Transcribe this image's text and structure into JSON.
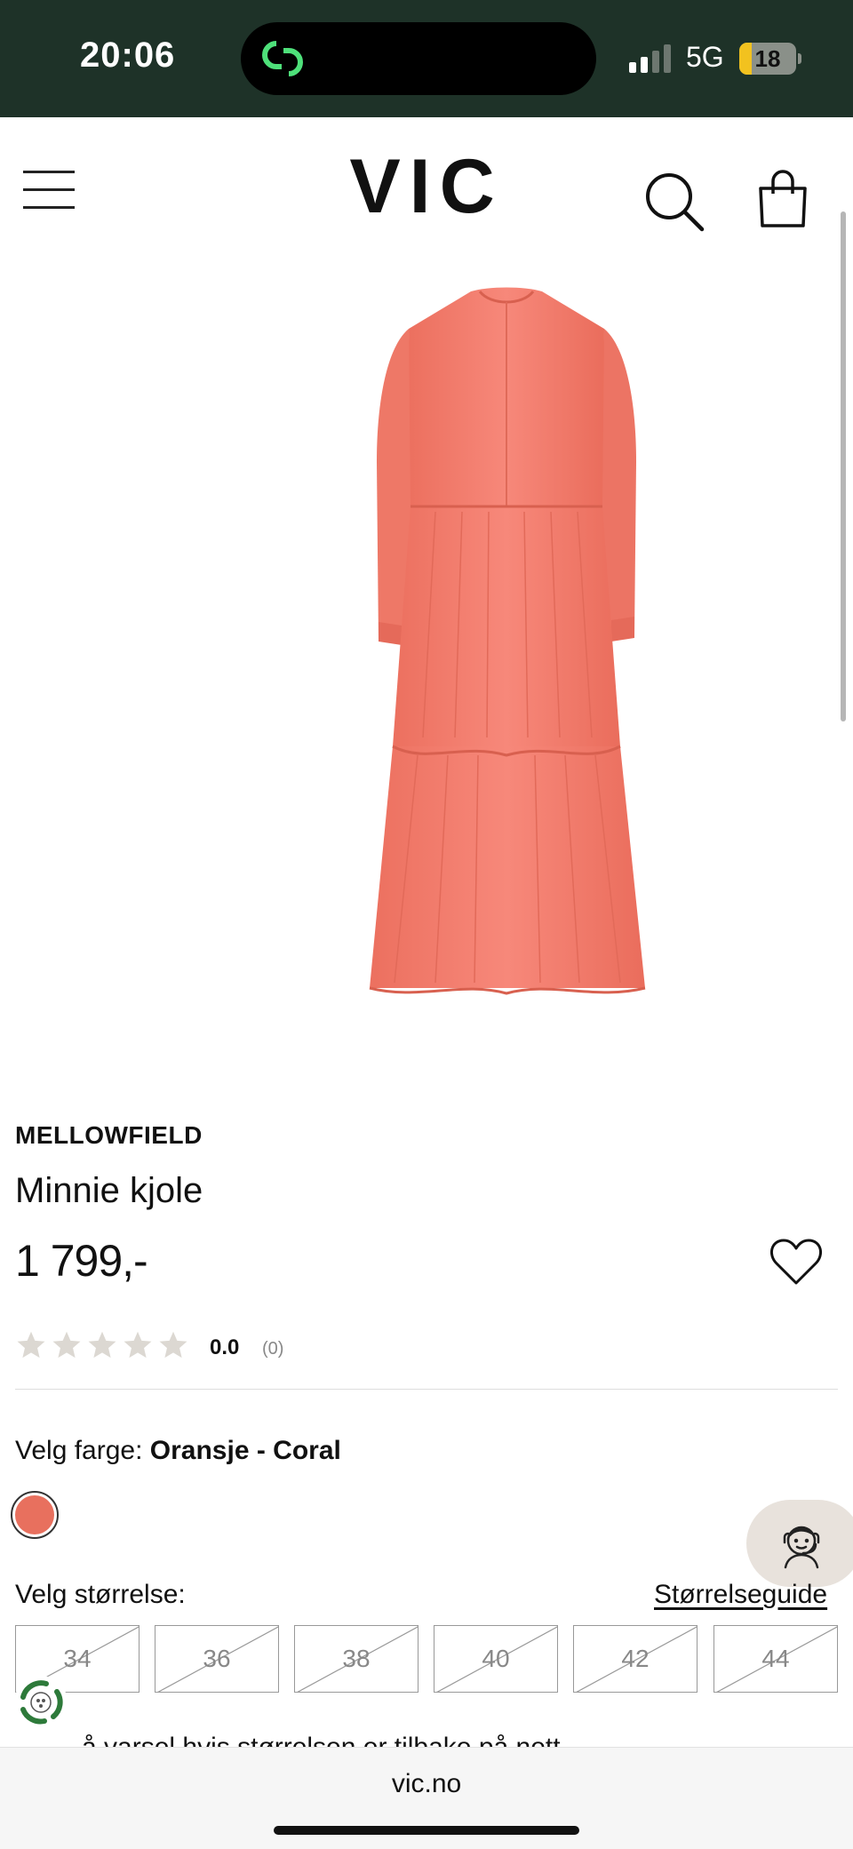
{
  "status_bar": {
    "time": "20:06",
    "network": "5G",
    "battery_level": "18",
    "signal_bars_active": 2,
    "signal_bars_total": 4
  },
  "header": {
    "logo": "VIC",
    "menu_icon": "hamburger-menu-icon",
    "search_icon": "search-icon",
    "cart_icon": "shopping-bag-icon"
  },
  "product": {
    "brand": "MELLOWFIELD",
    "name": "Minnie kjole",
    "price": "1 799,-",
    "image_color": "#f27d6c",
    "rating": {
      "stars_total": 5,
      "stars_filled": 0,
      "value": "0.0",
      "count": "(0)"
    }
  },
  "color_selector": {
    "label": "Velg farge:",
    "selected": "Oransje - Coral",
    "swatch_color": "#e8705e"
  },
  "size_selector": {
    "label": "Velg størrelse:",
    "guide_link": "Størrelseguide",
    "sizes": [
      {
        "label": "34",
        "available": false
      },
      {
        "label": "36",
        "available": false
      },
      {
        "label": "38",
        "available": false
      },
      {
        "label": "40",
        "available": false
      },
      {
        "label": "42",
        "available": false
      },
      {
        "label": "44",
        "available": false
      }
    ]
  },
  "notify_text": "å varsel hvis størrelsen er tilbake på nett",
  "browser": {
    "url": "vic.no"
  },
  "colors": {
    "status_bar_bg": "#1e3228",
    "accent_coral": "#e8705e",
    "chat_bg": "#e8e2dc",
    "eco_green": "#2d7a3a"
  }
}
